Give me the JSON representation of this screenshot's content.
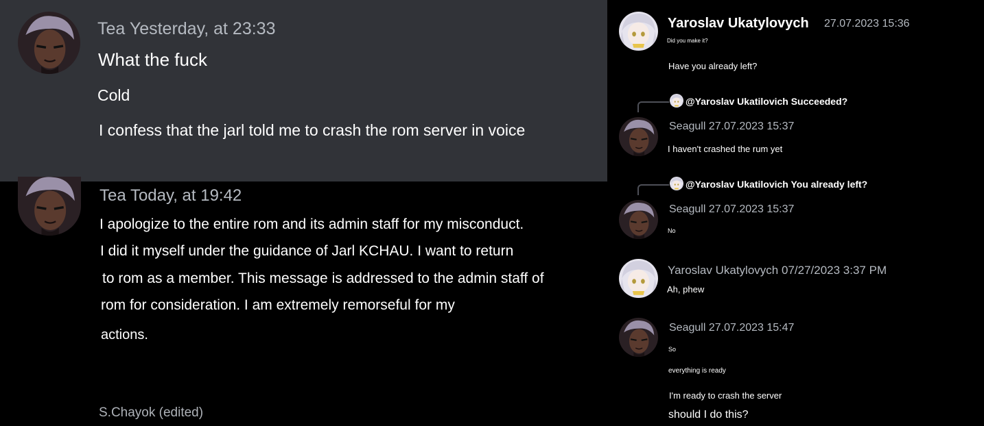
{
  "left": {
    "message1": {
      "author": "Tea",
      "timestamp": "Yesterday, at 23:33",
      "lines": [
        "What the fuck",
        "Cold",
        "I confess that the jarl told me to crash the rom server in voice"
      ]
    },
    "message2": {
      "author": "Tea",
      "timestamp": "Today, at 19:42",
      "lines": [
        "I apologize to the entire rom and its admin staff for my misconduct.",
        "I did it myself under the guidance of Jarl KCHAU. I want to return",
        "to rom as a member. This message is addressed to the admin staff of",
        "rom for consideration. I am extremely remorseful for my",
        "actions."
      ],
      "footer": "S.Chayok (edited)"
    }
  },
  "right": {
    "msg1": {
      "author": "Yaroslav Ukatylovych",
      "timestamp": "27.07.2023 15:36",
      "lines": [
        "Did you make it?",
        "Have you already left?"
      ]
    },
    "msg2": {
      "reply": "@Yaroslav Ukatilovich Succeeded?",
      "author": "Seagull",
      "timestamp": "27.07.2023 15:37",
      "lines": [
        "I haven't crashed the rum yet"
      ]
    },
    "msg3": {
      "reply": "@Yaroslav Ukatilovich You already left?",
      "author": "Seagull",
      "timestamp": "27.07.2023 15:37",
      "lines": [
        "No"
      ]
    },
    "msg4": {
      "author": "Yaroslav Ukatylovych",
      "timestamp": "07/27/2023 3:37 PM",
      "lines": [
        "Ah, phew"
      ]
    },
    "msg5": {
      "author": "Seagull",
      "timestamp": "27.07.2023 15:47",
      "lines": [
        "So",
        "everything is ready",
        "I'm ready to crash the server",
        "should I do this?"
      ]
    }
  },
  "colors": {
    "panel": "#313338",
    "background": "#000000",
    "muted": "#b5bac1"
  }
}
